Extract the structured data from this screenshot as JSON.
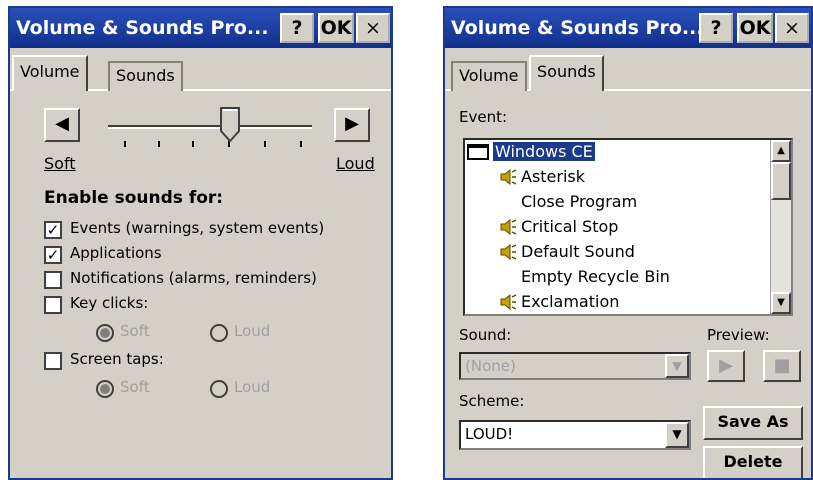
{
  "volume_window": {
    "title": "Volume & Sounds Pro...",
    "help": "?",
    "ok": "OK",
    "close": "×",
    "tabs": [
      "Volume",
      "Sounds"
    ],
    "soft_label": "Soft",
    "loud_label": "Loud",
    "enable_heading": "Enable sounds for:",
    "options": [
      {
        "label": "Events (warnings, system events)",
        "checked": true
      },
      {
        "label": "Applications",
        "checked": true
      },
      {
        "label": "Notifications (alarms, reminders)",
        "checked": false
      },
      {
        "label": "Key clicks:",
        "checked": false
      },
      {
        "label": "Screen taps:",
        "checked": false
      }
    ],
    "key_clicks_radios": [
      "Soft",
      "Loud"
    ],
    "screen_taps_radios": [
      "Soft",
      "Loud"
    ]
  },
  "sounds_window": {
    "title": "Volume & Sounds Pro...",
    "help": "?",
    "ok": "OK",
    "close": "×",
    "tabs": [
      "Volume",
      "Sounds"
    ],
    "event_label": "Event:",
    "events": [
      {
        "label": "Windows CE",
        "icon": "window-icon",
        "selected": true
      },
      {
        "label": "Asterisk",
        "icon": "speaker-icon"
      },
      {
        "label": "Close Program",
        "icon": ""
      },
      {
        "label": "Critical Stop",
        "icon": "speaker-icon"
      },
      {
        "label": "Default Sound",
        "icon": "speaker-icon"
      },
      {
        "label": "Empty Recycle Bin",
        "icon": ""
      },
      {
        "label": "Exclamation",
        "icon": "speaker-icon"
      }
    ],
    "sound_label": "Sound:",
    "sound_value": "(None)",
    "preview_label": "Preview:",
    "scheme_label": "Scheme:",
    "scheme_value": "LOUD!",
    "save_as": "Save As",
    "delete": "Delete"
  },
  "colors": {
    "titlebar": "#10308c",
    "face": "#d4d0c8",
    "selection": "#1a3a8a"
  }
}
